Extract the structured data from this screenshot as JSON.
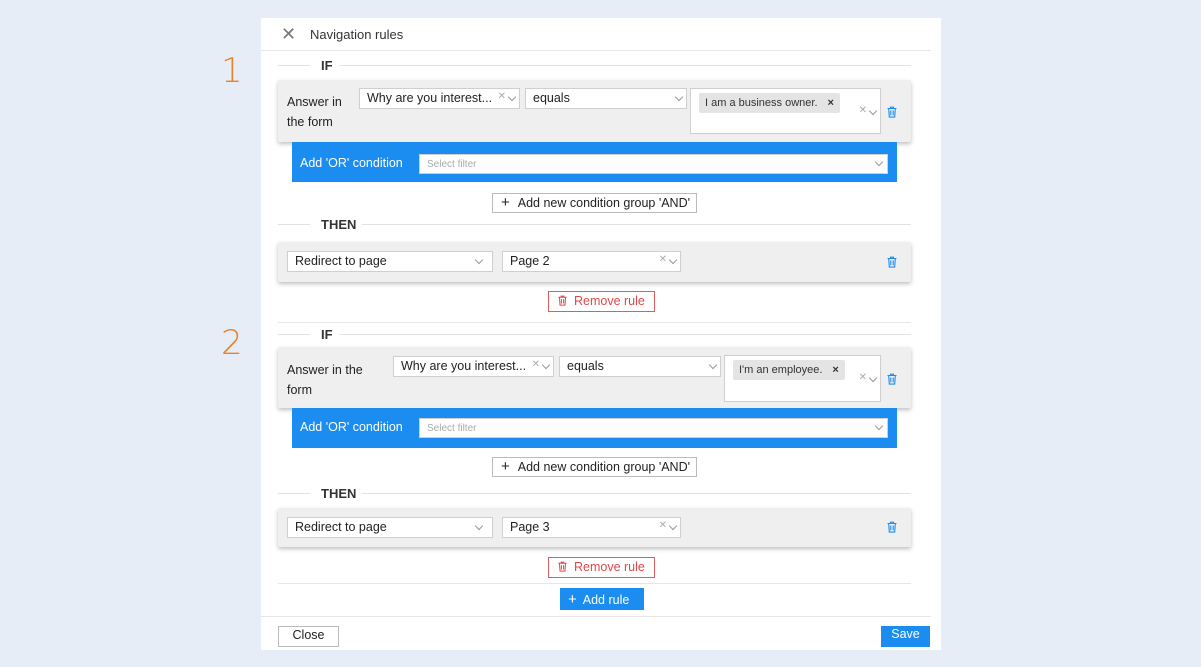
{
  "dialog": {
    "title": "Navigation rules"
  },
  "rules": [
    {
      "number": "1",
      "if_label": "IF",
      "condition_label": "Answer in the form",
      "question": "Why are you interest...",
      "operator": "equals",
      "answer_tag": "I am a business owner.",
      "or_label": "Add 'OR' condition",
      "or_placeholder": "Select filter",
      "and_button": "Add new condition group 'AND'",
      "then_label": "THEN",
      "action": "Redirect to page",
      "target": "Page 2",
      "remove_label": "Remove rule"
    },
    {
      "number": "2",
      "if_label": "IF",
      "condition_label": "Answer in the form",
      "question": "Why are you interest...",
      "operator": "equals",
      "answer_tag": "I'm an employee.",
      "or_label": "Add 'OR' condition",
      "or_placeholder": "Select filter",
      "and_button": "Add new condition group 'AND'",
      "then_label": "THEN",
      "action": "Redirect to page",
      "target": "Page 3",
      "remove_label": "Remove rule"
    }
  ],
  "add_rule_label": "Add rule",
  "footer": {
    "close_label": "Close",
    "save_label": "Save"
  },
  "colors": {
    "accent": "#1b8df0",
    "danger": "#e04848",
    "rule_number": "#e8822b",
    "background": "#e6edf6"
  },
  "icons": {
    "close": "close-icon",
    "clear": "clear-icon",
    "chevron": "chevron-down-icon",
    "trash": "trash-icon",
    "plus": "plus-icon"
  }
}
